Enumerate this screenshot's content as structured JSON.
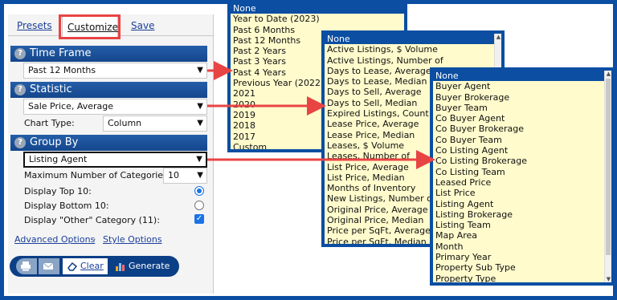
{
  "tabs": {
    "presets": "Presets",
    "customize": "Customize",
    "save": "Save"
  },
  "time_frame": {
    "title": "Time Frame",
    "value": "Past 12 Months"
  },
  "statistic": {
    "title": "Statistic",
    "value": "Sale Price, Average",
    "chart_type_label": "Chart Type:",
    "chart_type_value": "Column"
  },
  "group_by": {
    "title": "Group By",
    "value": "Listing Agent",
    "max_categories_label": "Maximum Number of Categories:",
    "max_categories_value": "10",
    "top10_label": "Display Top 10:",
    "bottom10_label": "Display Bottom 10:",
    "other_label": "Display \"Other\" Category (11):"
  },
  "links": {
    "advanced": "Advanced Options",
    "separator": "·",
    "style": "Style Options"
  },
  "toolbar": {
    "clear": "Clear",
    "generate": "Generate"
  },
  "time_frame_options": [
    "None",
    "Year to Date (2023)",
    "Past 6 Months",
    "Past 12 Months",
    "Past 2 Years",
    "Past 3 Years",
    "Past 4 Years",
    "Previous Year (2022)",
    "2021",
    "2020",
    "2019",
    "2018",
    "2017",
    "Custom"
  ],
  "statistic_options": [
    "None",
    "Active Listings, $ Volume",
    "Active Listings, Number of",
    "Days to Lease, Average",
    "Days to Lease, Median",
    "Days to Sell, Average",
    "Days to Sell, Median",
    "Expired Listings, Count",
    "Lease Price, Average",
    "Lease Price, Median",
    "Leases, $ Volume",
    "Leases, Number of",
    "List Price, Average",
    "List Price, Median",
    "Months of Inventory",
    "New Listings, Number of",
    "Original Price, Average",
    "Original Price, Median",
    "Price per SqFt, Average",
    "Price per SqFt, Median"
  ],
  "group_by_options": [
    "None",
    "Buyer Agent",
    "Buyer Brokerage",
    "Buyer Team",
    "Co Buyer Agent",
    "Co Buyer Brokerage",
    "Co Buyer Team",
    "Co Listing Agent",
    "Co Listing Brokerage",
    "Co Listing Team",
    "Leased Price",
    "List Price",
    "Listing Agent",
    "Listing Brokerage",
    "Listing Team",
    "Map Area",
    "Month",
    "Primary Year",
    "Property Sub Type",
    "Property Type"
  ],
  "colors": {
    "accent": "#0b4ea2",
    "highlight": "#e84444",
    "list_bg": "#fffbcc"
  }
}
